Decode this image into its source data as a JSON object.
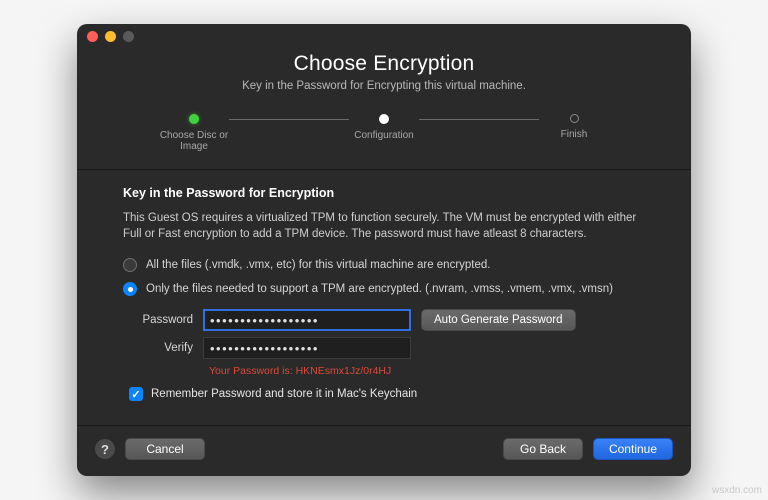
{
  "header": {
    "title": "Choose Encryption",
    "subtitle": "Key in the Password for Encrypting this virtual machine."
  },
  "steps": {
    "s1": "Choose Disc or Image",
    "s2": "Configuration",
    "s3": "Finish"
  },
  "section": {
    "title": "Key in the Password for Encryption",
    "desc": "This Guest OS requires a virtualized TPM to function securely. The VM must be encrypted with either Full or Fast encryption to add a TPM device. The password must have atleast 8 characters."
  },
  "options": {
    "full": "All the files (.vmdk, .vmx, etc) for this virtual machine are encrypted.",
    "fast": "Only the files needed to support a TPM are encrypted. (.nvram, .vmss, .vmem, .vmx, .vmsn)"
  },
  "form": {
    "password_label": "Password",
    "verify_label": "Verify",
    "password_mask": "••••••••••••••••••",
    "verify_mask": "••••••••••••••••••",
    "auto_btn": "Auto Generate Password",
    "hint_prefix": "Your Password is: ",
    "hint_value": "HKNEsmx1Jz/0r4HJ"
  },
  "remember": {
    "label": "Remember Password and store it in Mac's Keychain"
  },
  "footer": {
    "help": "?",
    "cancel": "Cancel",
    "back": "Go Back",
    "continue": "Continue"
  },
  "watermark": "wsxdn.com"
}
